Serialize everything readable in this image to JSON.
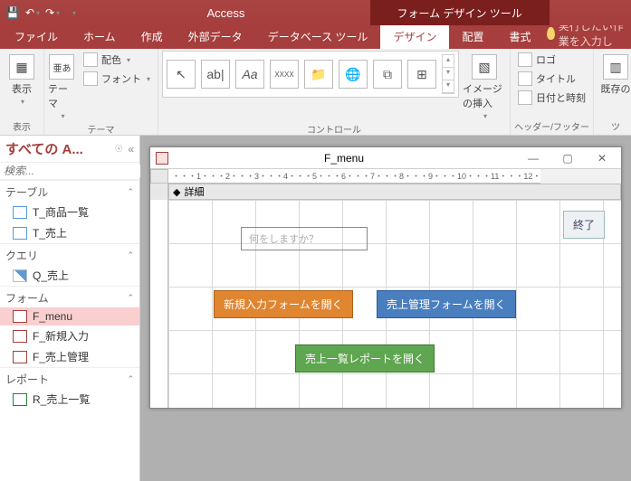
{
  "titlebar": {
    "app_name": "Access",
    "tool_tab_title": "フォーム デザイン ツール"
  },
  "qat": {
    "save": "💾",
    "undo": "↶",
    "redo": "↷",
    "more": "▾"
  },
  "tabs": {
    "file": "ファイル",
    "home": "ホーム",
    "create": "作成",
    "external": "外部データ",
    "dbtools": "データベース ツール",
    "design": "デザイン",
    "arrange": "配置",
    "format": "書式",
    "tellme": "実行したい作業を入力し"
  },
  "ribbon": {
    "view": {
      "label": "表示",
      "btn": "表示"
    },
    "themes": {
      "label": "テーマ",
      "theme_btn": "テーマ",
      "colors": "配色",
      "fonts": "フォント",
      "aa_icon": "亜あ"
    },
    "controls": {
      "label": "コントロール",
      "items": [
        "↖",
        "ab|",
        "Aa",
        "XXXX",
        "📁",
        "🌐",
        "⧉",
        "⊞",
        "▾"
      ],
      "image_btn": "イメージの挿入"
    },
    "header_footer": {
      "label": "ヘッダー/フッター",
      "logo": "ロゴ",
      "title": "タイトル",
      "date": "日付と時刻"
    },
    "tools": {
      "label": "ツ",
      "existing": "既存の"
    }
  },
  "nav": {
    "title": "すべての A...",
    "search_placeholder": "検索...",
    "sections": {
      "tables": "テーブル",
      "queries": "クエリ",
      "forms": "フォーム",
      "reports": "レポート"
    },
    "items": {
      "t1": "T_商品一覧",
      "t2": "T_売上",
      "q1": "Q_売上",
      "f1": "F_menu",
      "f2": "F_新規入力",
      "f3": "F_売上管理",
      "r1": "R_売上一覧"
    }
  },
  "form_window": {
    "title": "F_menu",
    "ruler_text": "・・・1・・・2・・・3・・・4・・・5・・・6・・・7・・・8・・・9・・・10・・・11・・・12・",
    "detail_section": "詳細",
    "controls": {
      "prompt": "何をしますか？",
      "btn_new": "新規入力フォームを開く",
      "btn_sales": "売上管理フォームを開く",
      "btn_report": "売上一覧レポートを開く",
      "btn_exit": "終了"
    }
  }
}
